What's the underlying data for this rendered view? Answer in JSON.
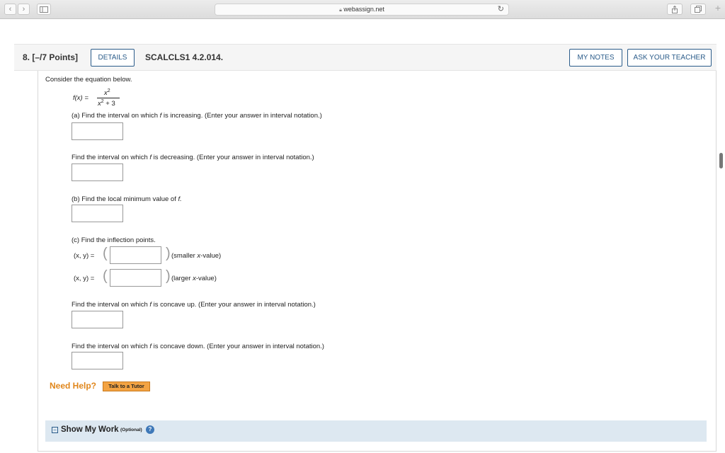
{
  "browser": {
    "url": "webassign.net",
    "back_icon": "chevron-left-icon",
    "forward_icon": "chevron-right-icon",
    "sidebar_icon": "sidebar-icon",
    "reload_icon": "reload-icon",
    "share_icon": "share-icon",
    "tabs_icon": "tabs-icon",
    "new_tab_icon": "plus-icon"
  },
  "question": {
    "number_points": "8. [–/7 Points]",
    "details_label": "DETAILS",
    "code": "SCALCLS1 4.2.014.",
    "my_notes_label": "MY NOTES",
    "ask_teacher_label": "ASK YOUR TEACHER"
  },
  "body": {
    "intro": "Consider the equation below.",
    "function_lhs": "f(x) =",
    "numerator": "x",
    "numerator_exp": "2",
    "denominator_var": "x",
    "denominator_exp": "2",
    "denominator_rest": " + 3",
    "part_a_pre": "(a) Find the interval on which ",
    "part_a_f": "f",
    "part_a_post": " is increasing. (Enter your answer in interval notation.)",
    "decreasing_pre": "Find the interval on which ",
    "decreasing_f": "f",
    "decreasing_post": " is decreasing. (Enter your answer in interval notation.)",
    "part_b_pre": "(b) Find the local minimum value of ",
    "part_b_f": "f.",
    "part_c": "(c) Find the inflection points.",
    "xy_label": "(x, y) =",
    "smaller_pre": "(smaller ",
    "smaller_x": "x",
    "smaller_post": "-value)",
    "larger_pre": "(larger ",
    "larger_x": "x",
    "larger_post": "-value)",
    "concave_up_pre": "Find the interval on which ",
    "concave_up_f": "f",
    "concave_up_post": " is concave up. (Enter your answer in interval notation.)",
    "concave_down_pre": "Find the interval on which ",
    "concave_down_f": "f",
    "concave_down_post": " is concave down. (Enter your answer in interval notation.)"
  },
  "help": {
    "need_help": "Need Help?",
    "tutor_label": "Talk to a Tutor"
  },
  "show_work": {
    "toggle": "−",
    "label": "Show My Work",
    "optional": "(Optional)",
    "help_icon_text": "?"
  }
}
